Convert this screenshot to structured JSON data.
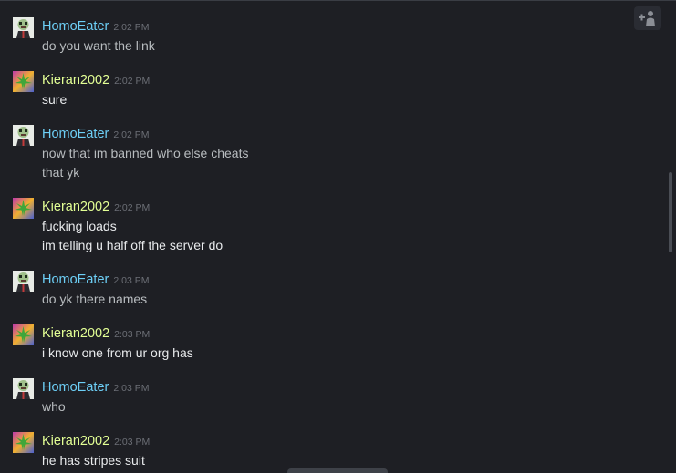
{
  "theme": {
    "background": "#1e1f24",
    "friend_name_color": "#6dcff6",
    "self_name_color": "#e3ff95",
    "timestamp_color": "#6b6e75",
    "text_color": "#dcdedf"
  },
  "toolbar": {
    "invite_icon": "add-friend-icon"
  },
  "messages": [
    {
      "sender": "HomoEater",
      "time": "2:02 PM",
      "lines": [
        "do you want the link"
      ],
      "avatar": "skull-mask-avatar"
    },
    {
      "sender": "Kieran2002",
      "time": "2:02 PM",
      "lines": [
        "sure"
      ],
      "avatar": "leaf-avatar"
    },
    {
      "sender": "HomoEater",
      "time": "2:02 PM",
      "lines": [
        "now that im banned who else cheats",
        "that yk"
      ],
      "avatar": "skull-mask-avatar"
    },
    {
      "sender": "Kieran2002",
      "time": "2:02 PM",
      "lines": [
        "fucking loads",
        "im telling u half off the server do"
      ],
      "avatar": "leaf-avatar"
    },
    {
      "sender": "HomoEater",
      "time": "2:03 PM",
      "lines": [
        "do yk there names"
      ],
      "avatar": "skull-mask-avatar"
    },
    {
      "sender": "Kieran2002",
      "time": "2:03 PM",
      "lines": [
        "i know one from ur org has"
      ],
      "avatar": "leaf-avatar"
    },
    {
      "sender": "HomoEater",
      "time": "2:03 PM",
      "lines": [
        "who"
      ],
      "avatar": "skull-mask-avatar"
    },
    {
      "sender": "Kieran2002",
      "time": "2:03 PM",
      "lines": [
        "he has stripes suit"
      ],
      "avatar": "leaf-avatar"
    }
  ]
}
